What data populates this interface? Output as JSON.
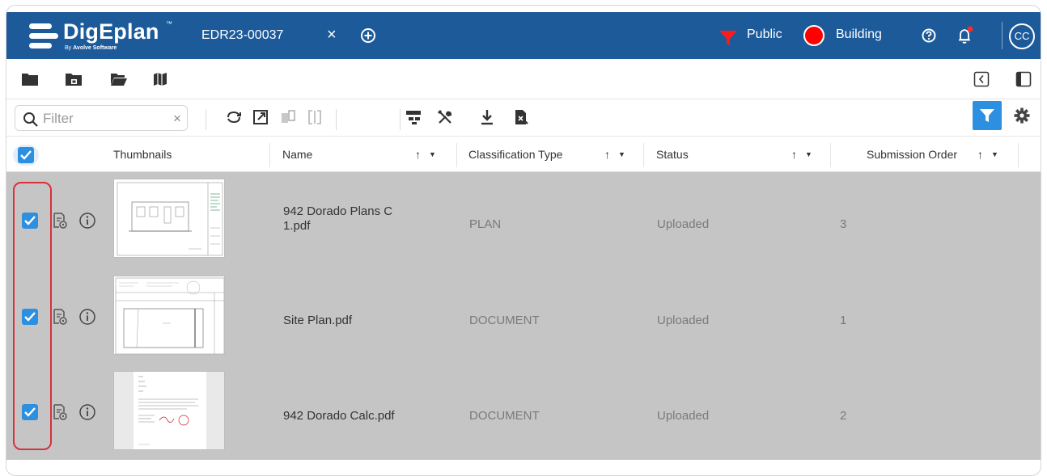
{
  "header": {
    "brand": "DigEplan",
    "brand_tm": "™",
    "brand_by": "By",
    "brand_company": "Avolve Software",
    "tab_label": "EDR23-00037",
    "close_symbol": "×",
    "visibility_label": "Public",
    "department_label": "Building",
    "user_initials": "CC",
    "colors": {
      "bar": "#1d5a99",
      "filter_accent": "#ff1a1a",
      "status_dot": "#ff0000"
    }
  },
  "navbar": {
    "icons": [
      "folder-icon",
      "folder-lock-icon",
      "folder-open-icon",
      "map-icon"
    ],
    "right_icons": [
      "collapse-left-icon",
      "panel-toggle-icon"
    ]
  },
  "toolbar": {
    "filter_placeholder": "Filter",
    "clear_symbol": "×",
    "icons": [
      "refresh-icon",
      "open-external-icon",
      "compare-icon",
      "split-view-icon",
      "hierarchy-icon",
      "tools-icon",
      "download-icon",
      "file-export-icon"
    ],
    "filter_button_icon": "funnel-icon",
    "settings_icon": "gear-icon",
    "accent": "#2d8fe0"
  },
  "table": {
    "columns": [
      {
        "key": "thumbnails",
        "label": "Thumbnails"
      },
      {
        "key": "name",
        "label": "Name"
      },
      {
        "key": "classification",
        "label": "Classification Type"
      },
      {
        "key": "status",
        "label": "Status"
      },
      {
        "key": "order",
        "label": "Submission Order"
      }
    ],
    "sort_glyph": "↑",
    "filter_glyph": "▼",
    "rows": [
      {
        "name_line1": "942 Dorado Plans C",
        "name_line2": "1.pdf",
        "classification": "PLAN",
        "status": "Uploaded",
        "order": "3",
        "checked": true
      },
      {
        "name_line1": "Site Plan.pdf",
        "name_line2": "",
        "classification": "DOCUMENT",
        "status": "Uploaded",
        "order": "1",
        "checked": true
      },
      {
        "name_line1": "942 Dorado Calc.pdf",
        "name_line2": "",
        "classification": "DOCUMENT",
        "status": "Uploaded",
        "order": "2",
        "checked": true
      }
    ],
    "row_background": "#c5c5c5",
    "highlight_outline": "#d9303d"
  }
}
